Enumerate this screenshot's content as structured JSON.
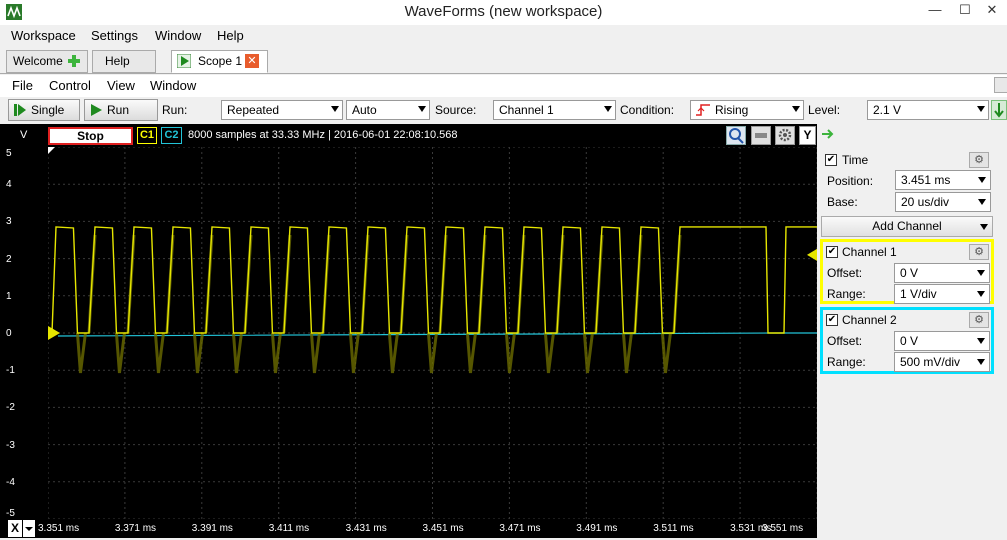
{
  "window": {
    "title": "WaveForms  (new workspace)",
    "minimize": "—",
    "maximize": "☐",
    "close": "✕"
  },
  "main_menu": [
    "Workspace",
    "Settings",
    "Window",
    "Help"
  ],
  "tabs": [
    {
      "label": "Welcome",
      "icon": "plus-icon"
    },
    {
      "label": "Help"
    },
    {
      "label": "Scope 1",
      "icon": "play-icon",
      "active": true
    }
  ],
  "scope_menu": [
    "File",
    "Control",
    "View",
    "Window"
  ],
  "toolbar": {
    "single_label": "Single",
    "run_label": "Run",
    "run_mode_label": "Run:",
    "run_mode_value": "Repeated",
    "trigger_mode_value": "Auto",
    "source_label": "Source:",
    "source_value": "Channel 1",
    "condition_label": "Condition:",
    "condition_value": "Rising",
    "level_label": "Level:",
    "level_value": "2.1 V"
  },
  "scope_header": {
    "units": "V",
    "stop_label": "Stop",
    "c1_label": "C1",
    "c2_label": "C2",
    "info": "8000 samples at 33.33 MHz | 2016-06-01 22:08:10.568",
    "y_button": "Y"
  },
  "y_axis": {
    "ticks": [
      "5",
      "4",
      "3",
      "2",
      "1",
      "0",
      "-1",
      "-2",
      "-3",
      "-4",
      "-5"
    ],
    "range": [
      -5,
      5
    ]
  },
  "x_axis": {
    "letter": "X",
    "ticks": [
      "3.351 ms",
      "3.371 ms",
      "3.391 ms",
      "3.411 ms",
      "3.431 ms",
      "3.451 ms",
      "3.471 ms",
      "3.491 ms",
      "3.511 ms",
      "3.531 ms",
      "3.551 ms"
    ]
  },
  "signals": {
    "channel1_high_v": 2.85,
    "channel1_low_v": 0.0,
    "channel1_color": "#e6e600",
    "channel2_level_v": 0.0,
    "channel2_color": "#22c4d8"
  },
  "panel": {
    "time": {
      "label": "Time",
      "position_label": "Position:",
      "position_value": "3.451 ms",
      "base_label": "Base:",
      "base_value": "20 us/div"
    },
    "add_channel_label": "Add Channel",
    "channel1": {
      "label": "Channel 1",
      "offset_label": "Offset:",
      "offset_value": "0 V",
      "range_label": "Range:",
      "range_value": "1 V/div",
      "color": "#ffff00"
    },
    "channel2": {
      "label": "Channel 2",
      "offset_label": "Offset:",
      "offset_value": "0 V",
      "range_label": "Range:",
      "range_value": "500 mV/div",
      "color": "#00e0ff"
    }
  }
}
